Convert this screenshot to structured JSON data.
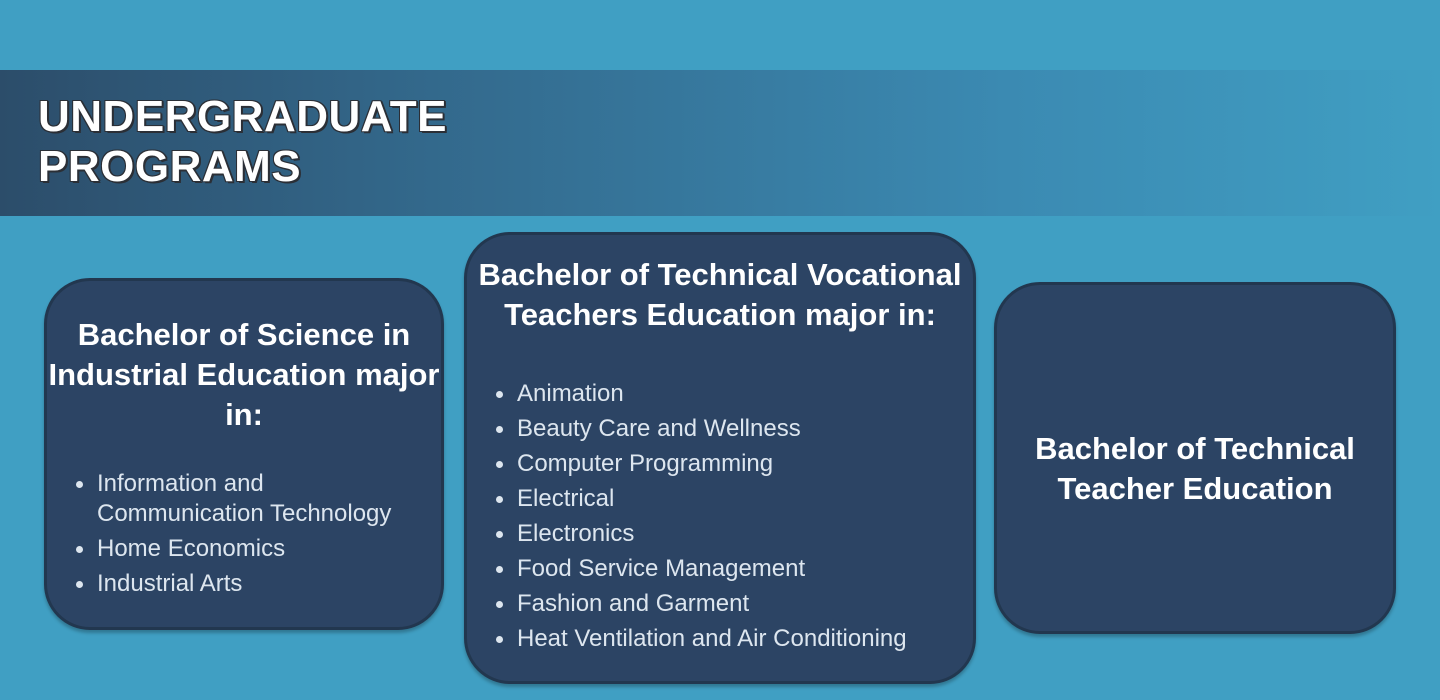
{
  "page": {
    "title_line1": "UNDERGRADUATE",
    "title_line2": "PROGRAMS"
  },
  "programs": [
    {
      "title": "Bachelor of Science in Industrial Education major in:",
      "majors": [
        "Information and Communication Technology",
        "Home Economics",
        "Industrial Arts"
      ]
    },
    {
      "title": "Bachelor of Technical Vocational Teachers Education major in:",
      "majors": [
        "Animation",
        "Beauty Care and Wellness",
        "Computer Programming",
        "Electrical",
        "Electronics",
        "Food Service Management",
        "Fashion and Garment",
        "Heat Ventilation and Air Conditioning"
      ]
    },
    {
      "title": "Bachelor of Technical Teacher Education",
      "majors": []
    }
  ],
  "colors": {
    "background": "#409fc3",
    "card": "#2c4464",
    "banner_dark": "#2c4d6a",
    "text": "#ffffff",
    "list_text": "#dde6ef"
  }
}
